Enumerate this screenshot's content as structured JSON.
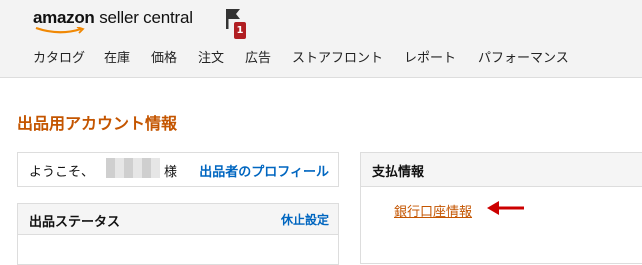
{
  "header": {
    "logo": {
      "brand": "amazon",
      "product": "seller central"
    },
    "flag_icon": "flag-icon",
    "notification_count": "1",
    "nav": [
      "カタログ",
      "在庫",
      "価格",
      "注文",
      "広告",
      "ストアフロント",
      "レポート",
      "パフォーマンス"
    ]
  },
  "page": {
    "title": "出品用アカウント情報"
  },
  "welcome": {
    "greeting": "ようこそ、",
    "suffix": "様",
    "profile_link": "出品者のプロフィール"
  },
  "status": {
    "title": "出品ステータス",
    "pause_link": "休止設定"
  },
  "payment": {
    "title": "支払情報",
    "bank_link": "銀行口座情報",
    "annotation_icon": "arrow-left-icon"
  },
  "colors": {
    "title_orange": "#c45500",
    "link_blue": "#0066c0",
    "badge_red": "#b11e22",
    "arrow_red": "#cc0000",
    "topbar_bg": "#f3f3f3"
  }
}
